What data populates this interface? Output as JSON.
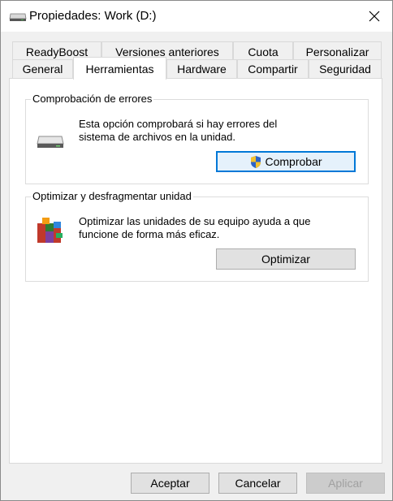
{
  "window": {
    "title": "Propiedades: Work (D:)"
  },
  "tabs": {
    "row1": [
      "ReadyBoost",
      "Versiones anteriores",
      "Cuota",
      "Personalizar"
    ],
    "row2": [
      "General",
      "Herramientas",
      "Hardware",
      "Compartir",
      "Seguridad"
    ],
    "active": "Herramientas"
  },
  "error_check": {
    "title": "Comprobación de errores",
    "line1": "Esta opción comprobará si hay errores del",
    "line2": "sistema de archivos en la unidad.",
    "button": "Comprobar",
    "icon": "drive-icon"
  },
  "optimize": {
    "title": "Optimizar y desfragmentar unidad",
    "line1": "Optimizar las unidades de su equipo ayuda a que",
    "line2": "funcione de forma más eficaz.",
    "button": "Optimizar",
    "icon": "defrag-icon"
  },
  "footer": {
    "ok": "Aceptar",
    "cancel": "Cancelar",
    "apply": "Aplicar"
  },
  "colors": {
    "accent": "#0078d7",
    "panel": "#ffffff",
    "chrome": "#f0f0f0"
  }
}
